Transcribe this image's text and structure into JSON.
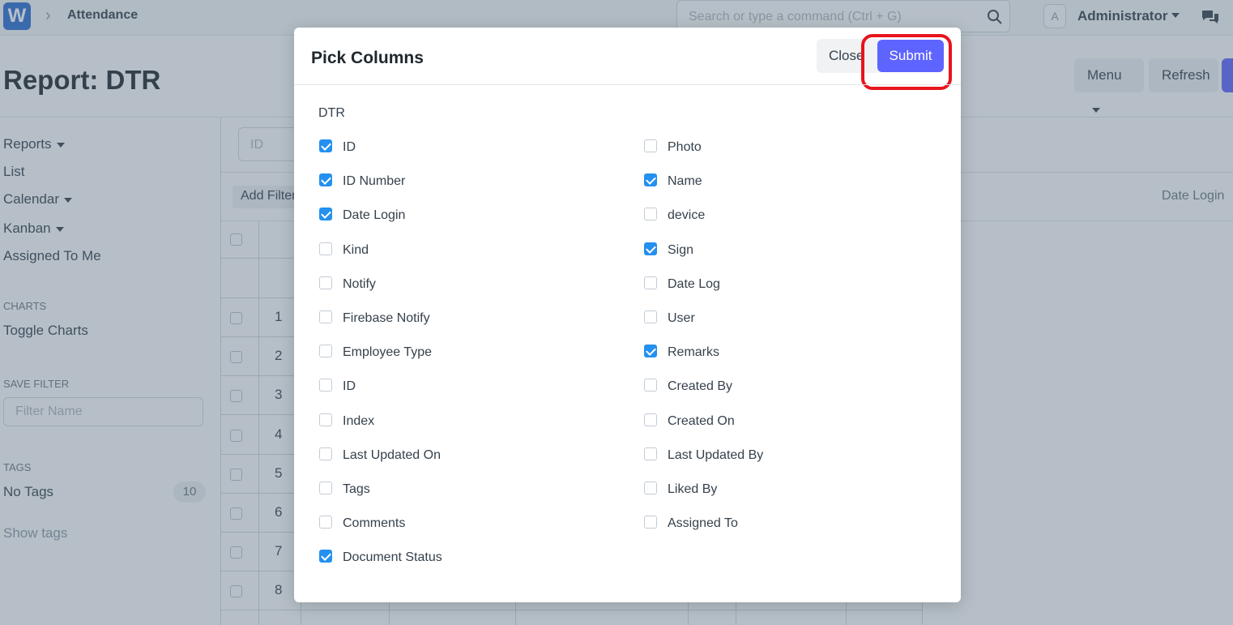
{
  "navbar": {
    "logo": "W",
    "breadcrumb": "Attendance",
    "search_placeholder": "Search or type a command (Ctrl + G)",
    "avatar_letter": "A",
    "user": "Administrator"
  },
  "page": {
    "title": "Report: DTR",
    "menu_label": "Menu",
    "refresh_label": "Refresh"
  },
  "sidebar": {
    "reports": "Reports",
    "list": "List",
    "calendar": "Calendar",
    "kanban": "Kanban",
    "assigned": "Assigned To Me",
    "charts_head": "CHARTS",
    "toggle_charts": "Toggle Charts",
    "save_filter_head": "SAVE FILTER",
    "filter_placeholder": "Filter Name",
    "tags_head": "TAGS",
    "no_tags": "No Tags",
    "no_tags_count": "10",
    "show_tags": "Show tags"
  },
  "grid": {
    "id_filter_placeholder": "ID",
    "add_filter": "Add Filter",
    "date_login_col": "Date Login",
    "rows": [
      "1",
      "2",
      "3",
      "4",
      "5",
      "6",
      "7",
      "8"
    ]
  },
  "modal": {
    "title": "Pick Columns",
    "close_label": "Close",
    "submit_label": "Submit",
    "section": "DTR",
    "left_columns": [
      {
        "label": "ID",
        "checked": true
      },
      {
        "label": "ID Number",
        "checked": true
      },
      {
        "label": "Date Login",
        "checked": true
      },
      {
        "label": "Kind",
        "checked": false
      },
      {
        "label": "Notify",
        "checked": false
      },
      {
        "label": "Firebase Notify",
        "checked": false
      },
      {
        "label": "Employee Type",
        "checked": false
      },
      {
        "label": "ID",
        "checked": false
      },
      {
        "label": "Index",
        "checked": false
      },
      {
        "label": "Last Updated On",
        "checked": false
      },
      {
        "label": "Tags",
        "checked": false
      },
      {
        "label": "Comments",
        "checked": false
      },
      {
        "label": "Document Status",
        "checked": true
      }
    ],
    "right_columns": [
      {
        "label": "Photo",
        "checked": false
      },
      {
        "label": "Name",
        "checked": true
      },
      {
        "label": "device",
        "checked": false
      },
      {
        "label": "Sign",
        "checked": true
      },
      {
        "label": "Date Log",
        "checked": false
      },
      {
        "label": "User",
        "checked": false
      },
      {
        "label": "Remarks",
        "checked": true
      },
      {
        "label": "Created By",
        "checked": false
      },
      {
        "label": "Created On",
        "checked": false
      },
      {
        "label": "Last Updated By",
        "checked": false
      },
      {
        "label": "Liked By",
        "checked": false
      },
      {
        "label": "Assigned To",
        "checked": false
      }
    ]
  },
  "colors": {
    "primary": "#5e64ff",
    "checkbox_checked": "#2490ef",
    "highlight": "#e8141c"
  }
}
